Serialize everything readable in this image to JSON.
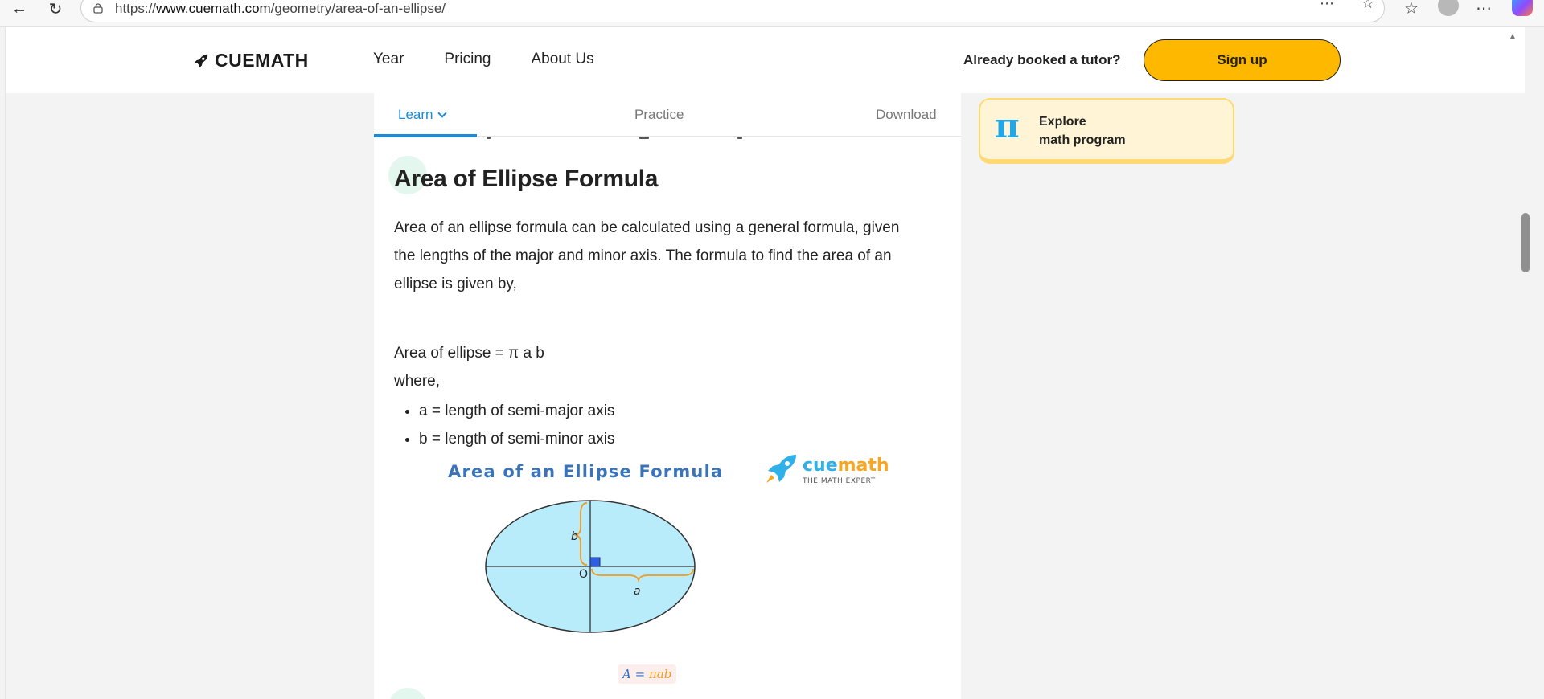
{
  "browser": {
    "url_prefix": "https://",
    "url_domain": "www.cuemath.com",
    "url_path": "/geometry/area-of-an-ellipse/",
    "icons": [
      "back-arrow-icon",
      "refresh-icon",
      "lock-icon",
      "read-aloud-icon",
      "favorite-star-icon",
      "favorites-icon",
      "profile-icon",
      "more-icon",
      "copilot-icon"
    ]
  },
  "header": {
    "logo_text": "CUEMATH",
    "nav": [
      "Year",
      "Pricing",
      "About Us"
    ],
    "booked_link": "Already booked a tutor?",
    "signup_label": "Sign up"
  },
  "tabs": {
    "learn": "Learn",
    "practice": "Practice",
    "download": "Download"
  },
  "article": {
    "title": "Area of Ellipse Formula",
    "paragraph": "Area of an ellipse formula can be calculated using a general formula, given the lengths of the major and minor axis. The formula to find the area of an ellipse is given by,",
    "formula": "Area of ellipse = π a b",
    "where": "where,",
    "bullets": [
      "a = length of semi-major axis",
      "b = length of semi-minor axis"
    ]
  },
  "figure": {
    "title": "Area of an Ellipse Formula",
    "logo_word_a": "cue",
    "logo_word_b": "math",
    "logo_tag": "THE MATH EXPERT",
    "label_b": "b",
    "label_a": "a",
    "label_o": "O",
    "formula_lhs": "A =",
    "formula_rhs": "πab",
    "colors": {
      "ellipse_fill": "#b8ecfb",
      "brace": "#f39a1e",
      "right_angle": "#2f5fe0"
    }
  },
  "sidebar": {
    "card_symbol": "π",
    "card_line1": "Explore",
    "card_line2": "math program"
  },
  "colors": {
    "accent_blue": "#1a8bd6",
    "signup_yellow": "#ffb800",
    "card_bg": "#fff5d6"
  }
}
